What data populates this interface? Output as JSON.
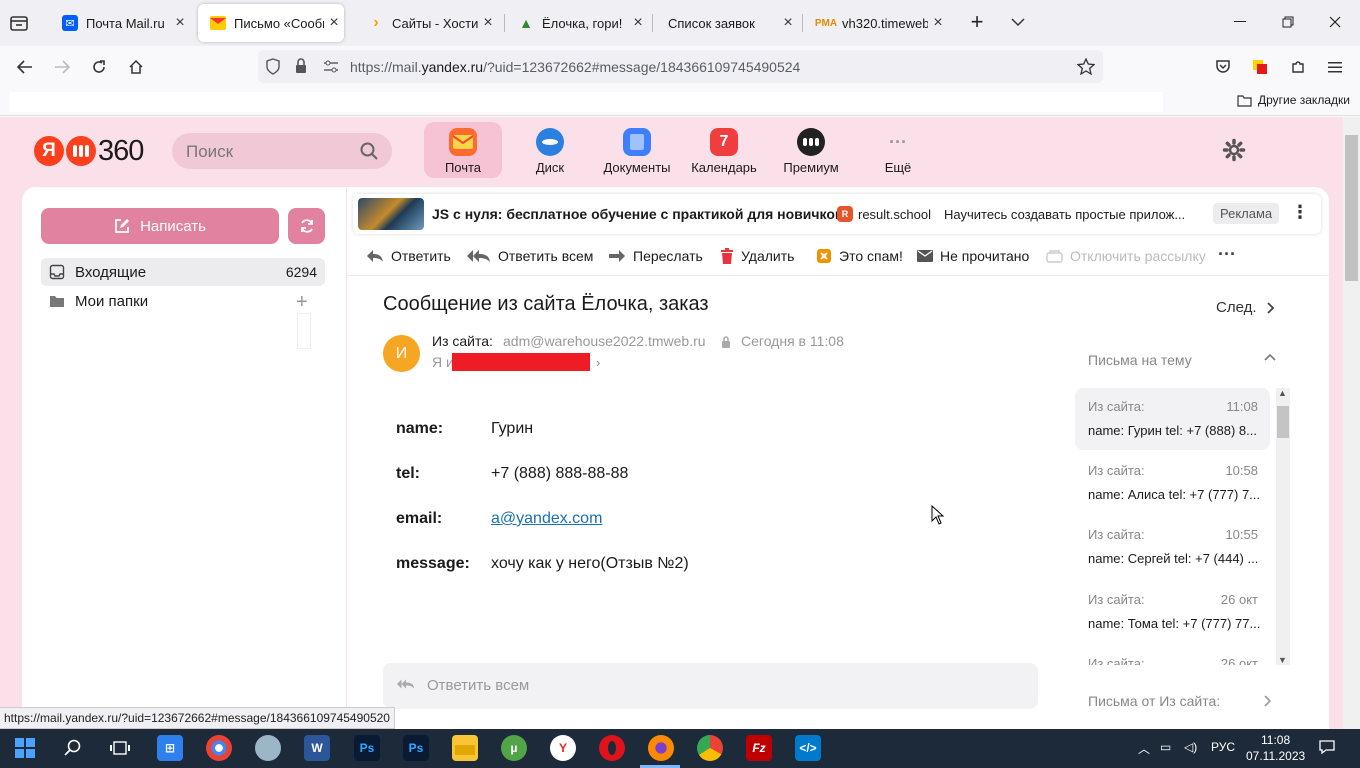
{
  "browser": {
    "tabs": [
      {
        "title": "Почта Mail.ru",
        "icon": "mailru-icon"
      },
      {
        "title": "Письмо «Сообщ",
        "icon": "yandex-mail-icon",
        "active": true
      },
      {
        "title": "Сайты - Хостин",
        "icon": "timeweb-icon"
      },
      {
        "title": "Ёлочка, гори!",
        "icon": "tree-icon"
      },
      {
        "title": "Список заявок",
        "icon": ""
      },
      {
        "title": "vh320.timeweb.r",
        "icon": "phpmyadmin-icon"
      }
    ],
    "url_prefix": "https://mail.",
    "url_host": "yandex.ru",
    "url_path": "/?uid=123672662#message/184366109745490524",
    "bookmarks_other": "Другие закладки",
    "status_url": "https://mail.yandex.ru/?uid=123672662#message/184366109745490520"
  },
  "header": {
    "logo_ya": "Я",
    "logo_360": "360",
    "search_placeholder": "Поиск",
    "apps": [
      {
        "label": "Почта",
        "icon": "mail-icon",
        "color": "#ff6a2f"
      },
      {
        "label": "Диск",
        "icon": "disk-icon",
        "color": "#2a7fe0"
      },
      {
        "label": "Документы",
        "icon": "docs-icon",
        "color": "#3d7fff"
      },
      {
        "label": "Календарь",
        "icon": "calendar-icon",
        "color": "#f03e3e",
        "badge": "7"
      },
      {
        "label": "Премиум",
        "icon": "premium-icon",
        "color": "#222222"
      },
      {
        "label": "Ещё",
        "icon": "more-icon",
        "color": ""
      }
    ]
  },
  "sidebar": {
    "compose_label": "Написать",
    "folders": [
      {
        "label": "Входящие",
        "count": "6294"
      },
      {
        "label": "Мои папки",
        "count": ""
      }
    ]
  },
  "ad": {
    "title": "JS с нуля: бесплатное обучение с практикой для новичков",
    "badge": "R",
    "domain": "result.school",
    "description": "Научитесь создавать простые прилож...",
    "label": "Реклама"
  },
  "toolbar": {
    "reply": "Ответить",
    "reply_all": "Ответить всем",
    "forward": "Переслать",
    "delete": "Удалить",
    "spam": "Это спам!",
    "unread": "Не прочитано",
    "unsubscribe": "Отключить рассылку"
  },
  "message": {
    "subject": "Сообщение из сайта Ёлочка, заказ",
    "next_label": "След.",
    "avatar_letter": "И",
    "from_name": "Из сайта:",
    "from_email": "adm@warehouse2022.tmweb.ru",
    "date": "Сегодня в 11:08",
    "to_label": "Я и",
    "fields": [
      {
        "key": "name:",
        "value": "Гурин"
      },
      {
        "key": "tel:",
        "value": "+7 (888) 888-88-88"
      },
      {
        "key": "email:",
        "value": "a@yandex.com"
      },
      {
        "key": "message:",
        "value": "хочу как у него(Отзыв №2)"
      }
    ],
    "reply_all_placeholder": "Ответить всем"
  },
  "thread": {
    "title": "Письма на тему",
    "items": [
      {
        "from": "Из сайта:",
        "time": "11:08",
        "preview": "name: Гурин tel: +7 (888) 8..."
      },
      {
        "from": "Из сайта:",
        "time": "10:58",
        "preview": "name: Алиса tel: +7 (777) 7..."
      },
      {
        "from": "Из сайта:",
        "time": "10:55",
        "preview": "name: Сергей tel: +7 (444) ..."
      },
      {
        "from": "Из сайта:",
        "time": "26 окт",
        "preview": "name: Тома tel: +7 (777) 77..."
      },
      {
        "from": "Из сайта:",
        "time": "26 окт",
        "preview": ""
      }
    ],
    "letters_from": "Письма от Из сайта:"
  },
  "taskbar": {
    "lang": "РУС",
    "time": "11:08",
    "date": "07.11.2023"
  },
  "colors": {
    "page_bg": "#fbe0ea",
    "accent_pink": "#e082a0",
    "redaction": "#ee1c24",
    "avatar": "#f5a623",
    "link": "#1a6fb5"
  }
}
